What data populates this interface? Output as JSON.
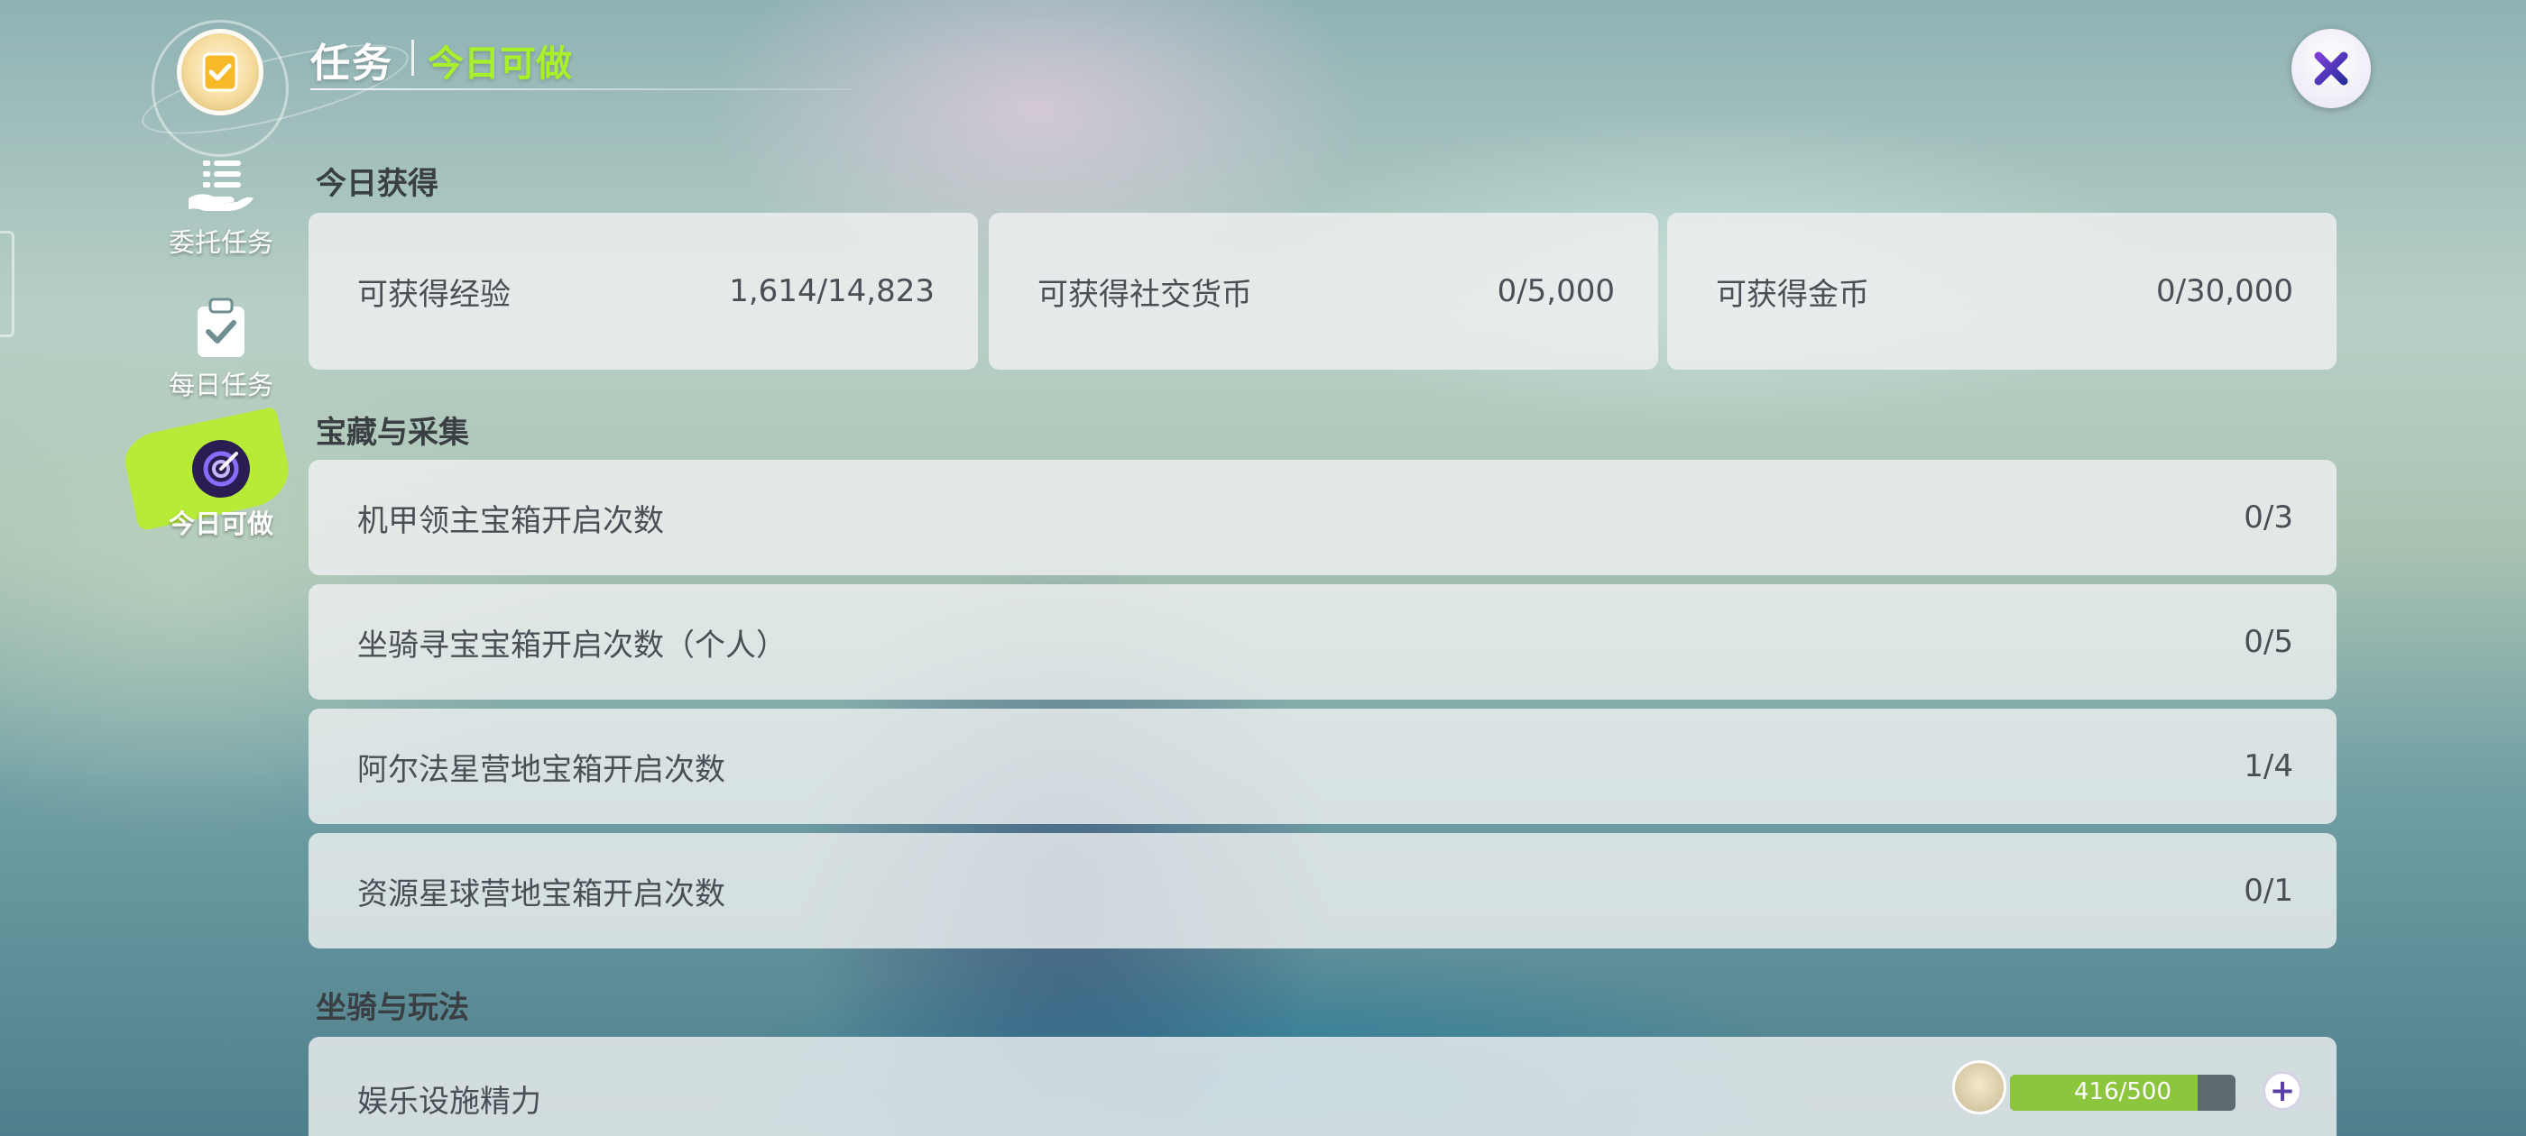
{
  "header": {
    "title": "任务",
    "subtitle": "今日可做",
    "close_icon": "close-x-icon"
  },
  "sidebar": {
    "items": [
      {
        "label": "委托任务",
        "icon": "hand-list-icon",
        "active": false
      },
      {
        "label": "每日任务",
        "icon": "clipboard-check-icon",
        "active": false
      },
      {
        "label": "今日可做",
        "icon": "target-icon",
        "active": true
      }
    ],
    "active_color": "#b6ef2c"
  },
  "sections": {
    "today_gain": {
      "title": "今日获得",
      "cards": [
        {
          "label": "可获得经验",
          "value": "1,614/14,823"
        },
        {
          "label": "可获得社交货币",
          "value": "0/5,000"
        },
        {
          "label": "可获得金币",
          "value": "0/30,000"
        }
      ]
    },
    "treasure": {
      "title": "宝藏与采集",
      "rows": [
        {
          "label": "机甲领主宝箱开启次数",
          "value": "0/3"
        },
        {
          "label": "坐骑寻宝宝箱开启次数（个人）",
          "value": "0/5"
        },
        {
          "label": "阿尔法星营地宝箱开启次数",
          "value": "1/4"
        },
        {
          "label": "资源星球营地宝箱开启次数",
          "value": "0/1"
        }
      ]
    },
    "mounts": {
      "title": "坐骑与玩法",
      "rows": [
        {
          "label": "娱乐设施精力",
          "energy_text": "416/500",
          "energy_fraction": 0.832
        }
      ]
    }
  },
  "colors": {
    "accent_green": "#a8f02a",
    "card_bg": "#eef0f0",
    "text_dark": "#4a4f55"
  }
}
